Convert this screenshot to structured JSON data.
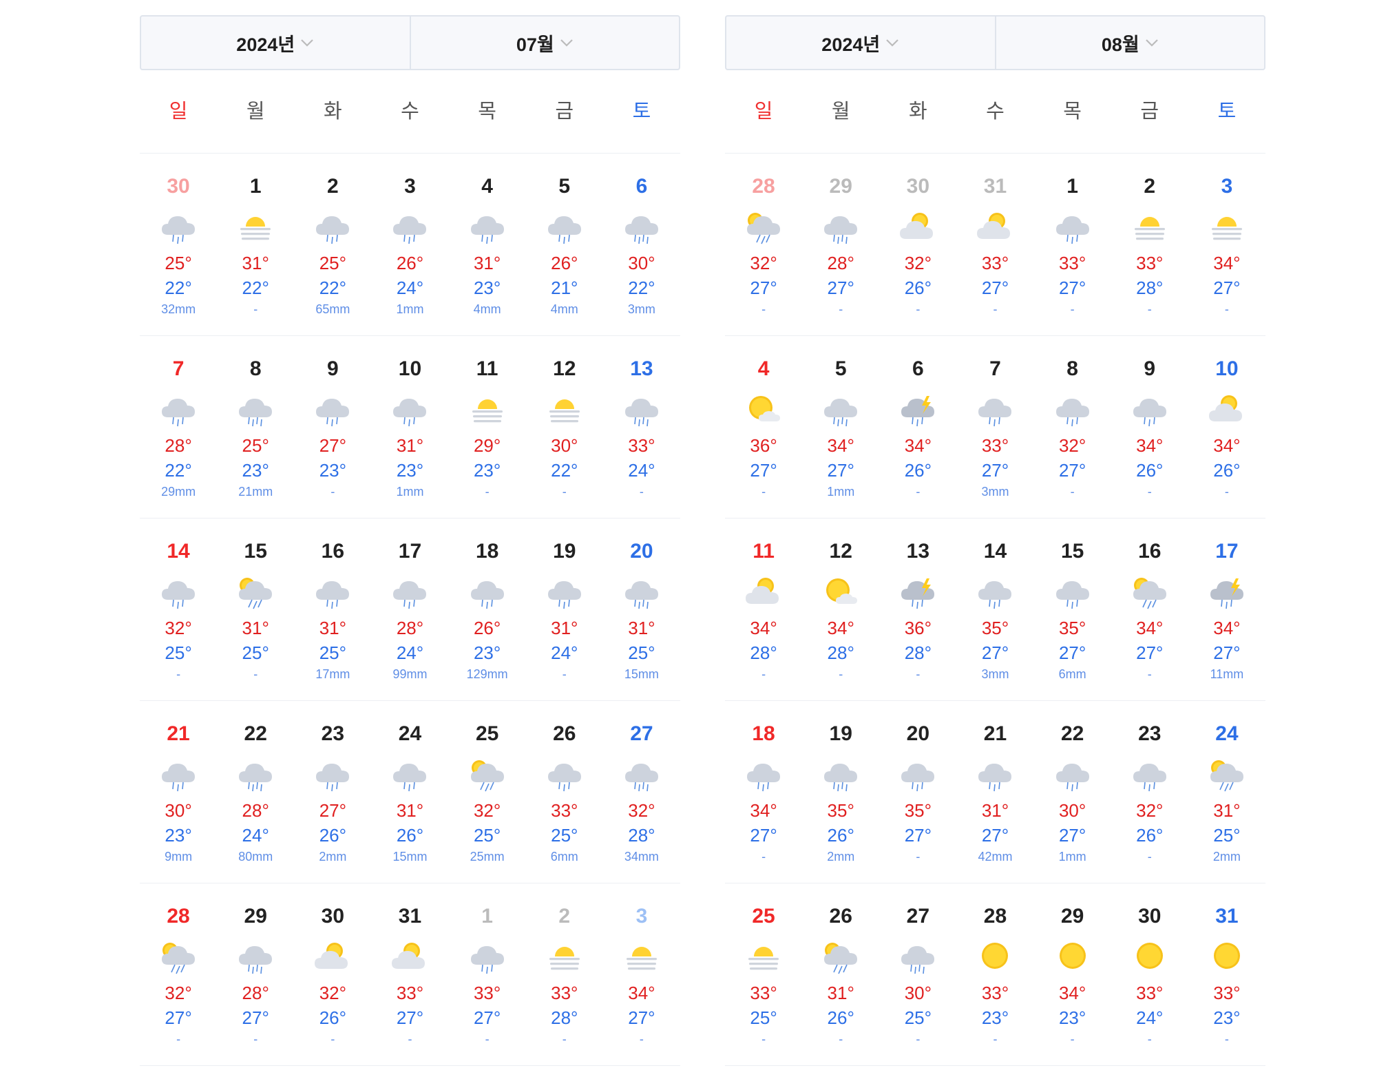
{
  "weekday_labels": [
    "일",
    "월",
    "화",
    "수",
    "목",
    "금",
    "토"
  ],
  "months": [
    {
      "year_label": "2024년",
      "month_label": "07월",
      "weeks": [
        [
          {
            "date": "30",
            "other": true,
            "icon": "rain",
            "hi": "25°",
            "lo": "22°",
            "rain": "32mm"
          },
          {
            "date": "1",
            "icon": "sun-haze",
            "hi": "31°",
            "lo": "22°",
            "rain": "-"
          },
          {
            "date": "2",
            "icon": "rain",
            "hi": "25°",
            "lo": "22°",
            "rain": "65mm"
          },
          {
            "date": "3",
            "icon": "rain",
            "hi": "26°",
            "lo": "24°",
            "rain": "1mm"
          },
          {
            "date": "4",
            "icon": "rain",
            "hi": "31°",
            "lo": "23°",
            "rain": "4mm"
          },
          {
            "date": "5",
            "icon": "rain",
            "hi": "26°",
            "lo": "21°",
            "rain": "4mm"
          },
          {
            "date": "6",
            "icon": "heavy-rain",
            "hi": "30°",
            "lo": "22°",
            "rain": "3mm"
          }
        ],
        [
          {
            "date": "7",
            "icon": "rain",
            "hi": "28°",
            "lo": "22°",
            "rain": "29mm"
          },
          {
            "date": "8",
            "icon": "heavy-rain",
            "hi": "25°",
            "lo": "23°",
            "rain": "21mm"
          },
          {
            "date": "9",
            "icon": "rain",
            "hi": "27°",
            "lo": "23°",
            "rain": "-"
          },
          {
            "date": "10",
            "icon": "rain",
            "hi": "31°",
            "lo": "23°",
            "rain": "1mm"
          },
          {
            "date": "11",
            "icon": "sun-haze",
            "hi": "29°",
            "lo": "23°",
            "rain": "-"
          },
          {
            "date": "12",
            "icon": "sun-haze",
            "hi": "30°",
            "lo": "22°",
            "rain": "-"
          },
          {
            "date": "13",
            "icon": "heavy-rain",
            "hi": "33°",
            "lo": "24°",
            "rain": "-"
          }
        ],
        [
          {
            "date": "14",
            "icon": "rain",
            "hi": "32°",
            "lo": "25°",
            "rain": "-"
          },
          {
            "date": "15",
            "icon": "sun-shower",
            "hi": "31°",
            "lo": "25°",
            "rain": "-"
          },
          {
            "date": "16",
            "icon": "rain",
            "hi": "31°",
            "lo": "25°",
            "rain": "17mm"
          },
          {
            "date": "17",
            "icon": "rain",
            "hi": "28°",
            "lo": "24°",
            "rain": "99mm"
          },
          {
            "date": "18",
            "icon": "rain",
            "hi": "26°",
            "lo": "23°",
            "rain": "129mm"
          },
          {
            "date": "19",
            "icon": "rain",
            "hi": "31°",
            "lo": "24°",
            "rain": "-"
          },
          {
            "date": "20",
            "icon": "heavy-rain",
            "hi": "31°",
            "lo": "25°",
            "rain": "15mm"
          }
        ],
        [
          {
            "date": "21",
            "icon": "rain",
            "hi": "30°",
            "lo": "23°",
            "rain": "9mm"
          },
          {
            "date": "22",
            "icon": "heavy-rain",
            "hi": "28°",
            "lo": "24°",
            "rain": "80mm"
          },
          {
            "date": "23",
            "icon": "rain",
            "hi": "27°",
            "lo": "26°",
            "rain": "2mm"
          },
          {
            "date": "24",
            "icon": "rain",
            "hi": "31°",
            "lo": "26°",
            "rain": "15mm"
          },
          {
            "date": "25",
            "icon": "sun-shower",
            "hi": "32°",
            "lo": "25°",
            "rain": "25mm"
          },
          {
            "date": "26",
            "icon": "rain",
            "hi": "33°",
            "lo": "25°",
            "rain": "6mm"
          },
          {
            "date": "27",
            "icon": "heavy-rain",
            "hi": "32°",
            "lo": "28°",
            "rain": "34mm"
          }
        ],
        [
          {
            "date": "28",
            "icon": "sun-shower",
            "hi": "32°",
            "lo": "27°",
            "rain": "-"
          },
          {
            "date": "29",
            "icon": "heavy-rain",
            "hi": "28°",
            "lo": "27°",
            "rain": "-"
          },
          {
            "date": "30",
            "icon": "partly-cloudy",
            "hi": "32°",
            "lo": "26°",
            "rain": "-"
          },
          {
            "date": "31",
            "icon": "partly-cloudy",
            "hi": "33°",
            "lo": "27°",
            "rain": "-"
          },
          {
            "date": "1",
            "other": true,
            "icon": "rain",
            "hi": "33°",
            "lo": "27°",
            "rain": "-"
          },
          {
            "date": "2",
            "other": true,
            "icon": "sun-haze",
            "hi": "33°",
            "lo": "28°",
            "rain": "-"
          },
          {
            "date": "3",
            "other": true,
            "icon": "sun-haze",
            "hi": "34°",
            "lo": "27°",
            "rain": "-"
          }
        ]
      ]
    },
    {
      "year_label": "2024년",
      "month_label": "08월",
      "weeks": [
        [
          {
            "date": "28",
            "other": true,
            "icon": "sun-shower",
            "hi": "32°",
            "lo": "27°",
            "rain": "-"
          },
          {
            "date": "29",
            "other": true,
            "icon": "heavy-rain",
            "hi": "28°",
            "lo": "27°",
            "rain": "-"
          },
          {
            "date": "30",
            "other": true,
            "icon": "partly-cloudy",
            "hi": "32°",
            "lo": "26°",
            "rain": "-"
          },
          {
            "date": "31",
            "other": true,
            "icon": "partly-cloudy",
            "hi": "33°",
            "lo": "27°",
            "rain": "-"
          },
          {
            "date": "1",
            "icon": "rain",
            "hi": "33°",
            "lo": "27°",
            "rain": "-"
          },
          {
            "date": "2",
            "icon": "sun-haze",
            "hi": "33°",
            "lo": "28°",
            "rain": "-"
          },
          {
            "date": "3",
            "icon": "sun-haze",
            "hi": "34°",
            "lo": "27°",
            "rain": "-"
          }
        ],
        [
          {
            "date": "4",
            "icon": "mostly-sunny",
            "hi": "36°",
            "lo": "27°",
            "rain": "-"
          },
          {
            "date": "5",
            "icon": "heavy-rain",
            "hi": "34°",
            "lo": "27°",
            "rain": "1mm"
          },
          {
            "date": "6",
            "icon": "thunder",
            "hi": "34°",
            "lo": "26°",
            "rain": "-"
          },
          {
            "date": "7",
            "icon": "rain",
            "hi": "33°",
            "lo": "27°",
            "rain": "3mm"
          },
          {
            "date": "8",
            "icon": "rain",
            "hi": "32°",
            "lo": "27°",
            "rain": "-"
          },
          {
            "date": "9",
            "icon": "rain",
            "hi": "34°",
            "lo": "26°",
            "rain": "-"
          },
          {
            "date": "10",
            "icon": "partly-cloudy",
            "hi": "34°",
            "lo": "26°",
            "rain": "-"
          }
        ],
        [
          {
            "date": "11",
            "icon": "partly-cloudy",
            "hi": "34°",
            "lo": "28°",
            "rain": "-"
          },
          {
            "date": "12",
            "icon": "mostly-sunny",
            "hi": "34°",
            "lo": "28°",
            "rain": "-"
          },
          {
            "date": "13",
            "icon": "thunder",
            "hi": "36°",
            "lo": "28°",
            "rain": "-"
          },
          {
            "date": "14",
            "icon": "rain",
            "hi": "35°",
            "lo": "27°",
            "rain": "3mm"
          },
          {
            "date": "15",
            "icon": "rain",
            "hi": "35°",
            "lo": "27°",
            "rain": "6mm"
          },
          {
            "date": "16",
            "icon": "sun-shower",
            "hi": "34°",
            "lo": "27°",
            "rain": "-"
          },
          {
            "date": "17",
            "icon": "thunder",
            "hi": "34°",
            "lo": "27°",
            "rain": "11mm"
          }
        ],
        [
          {
            "date": "18",
            "icon": "rain",
            "hi": "34°",
            "lo": "27°",
            "rain": "-"
          },
          {
            "date": "19",
            "icon": "heavy-rain",
            "hi": "35°",
            "lo": "26°",
            "rain": "2mm"
          },
          {
            "date": "20",
            "icon": "rain",
            "hi": "35°",
            "lo": "27°",
            "rain": "-"
          },
          {
            "date": "21",
            "icon": "rain",
            "hi": "31°",
            "lo": "27°",
            "rain": "42mm"
          },
          {
            "date": "22",
            "icon": "rain",
            "hi": "30°",
            "lo": "27°",
            "rain": "1mm"
          },
          {
            "date": "23",
            "icon": "rain",
            "hi": "32°",
            "lo": "26°",
            "rain": "-"
          },
          {
            "date": "24",
            "icon": "sun-shower",
            "hi": "31°",
            "lo": "25°",
            "rain": "2mm"
          }
        ],
        [
          {
            "date": "25",
            "icon": "sun-haze",
            "hi": "33°",
            "lo": "25°",
            "rain": "-"
          },
          {
            "date": "26",
            "icon": "sun-shower",
            "hi": "31°",
            "lo": "26°",
            "rain": "-"
          },
          {
            "date": "27",
            "icon": "heavy-rain",
            "hi": "30°",
            "lo": "25°",
            "rain": "-"
          },
          {
            "date": "28",
            "icon": "sunny",
            "hi": "33°",
            "lo": "23°",
            "rain": "-"
          },
          {
            "date": "29",
            "icon": "sunny",
            "hi": "34°",
            "lo": "23°",
            "rain": "-"
          },
          {
            "date": "30",
            "icon": "sunny",
            "hi": "33°",
            "lo": "24°",
            "rain": "-"
          },
          {
            "date": "31",
            "icon": "sunny",
            "hi": "33°",
            "lo": "23°",
            "rain": "-"
          }
        ]
      ]
    }
  ]
}
